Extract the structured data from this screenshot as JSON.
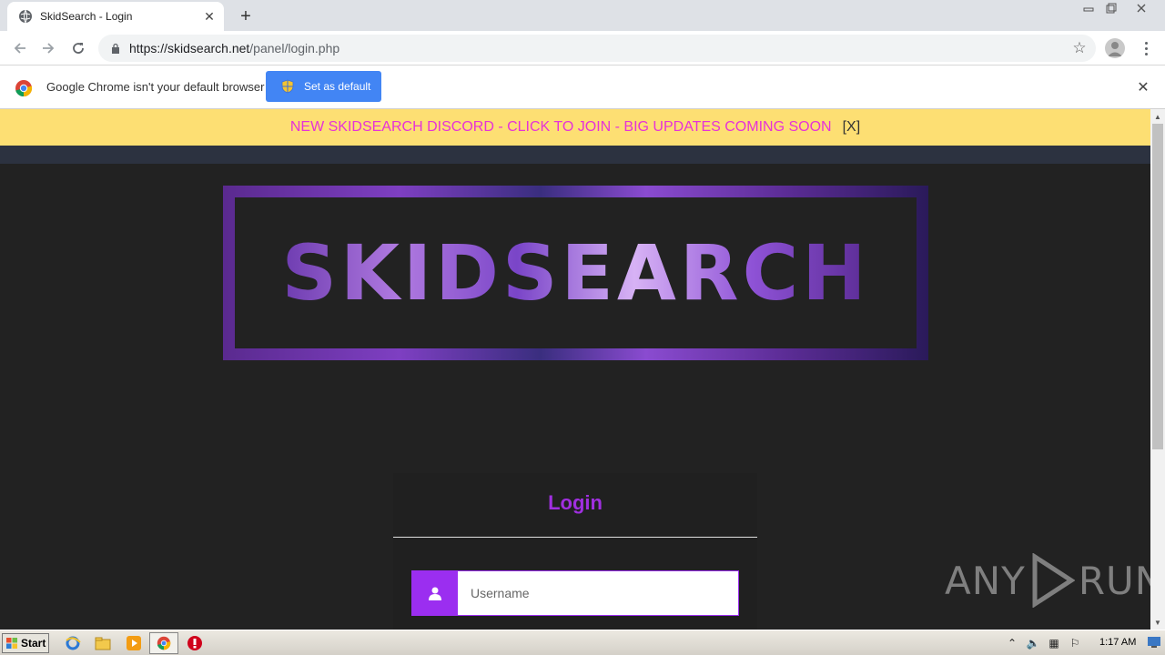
{
  "browser": {
    "tab_title": "SkidSearch - Login",
    "url_host": "https://skidsearch.net",
    "url_path": "/panel/login.php"
  },
  "infobar": {
    "message": "Google Chrome isn't your default browser",
    "set_default_label": "Set as default"
  },
  "page": {
    "announcement": "NEW SKIDSEARCH DISCORD - CLICK TO JOIN - BIG UPDATES COMING SOON",
    "announcement_close": "[X]",
    "banner_text": "SKIDSEARCH",
    "login": {
      "title": "Login",
      "username_placeholder": "Username"
    },
    "watermark": {
      "left": "ANY",
      "right": "RUN"
    }
  },
  "taskbar": {
    "start_label": "Start",
    "clock": "1:17 AM"
  },
  "colors": {
    "accent_purple": "#9b2ef0",
    "announce_bg": "#fddf73",
    "announce_text": "#e632d8",
    "chrome_blue": "#4285f4"
  }
}
